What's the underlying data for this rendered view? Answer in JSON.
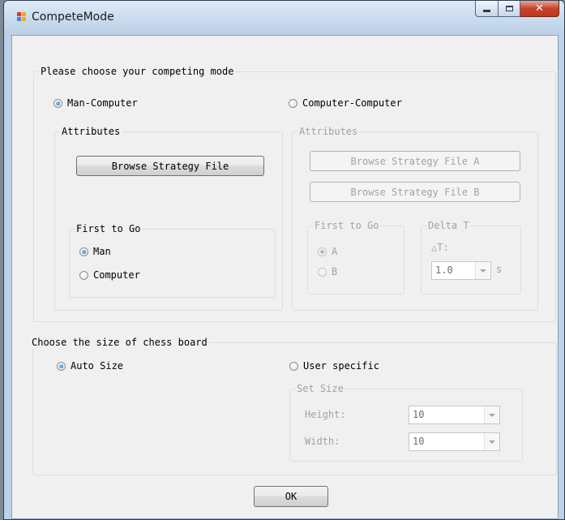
{
  "window": {
    "title": "CompeteMode"
  },
  "mode_group": {
    "legend": "Please choose your competing mode",
    "man_computer": "Man-Computer",
    "computer_computer": "Computer-Computer",
    "left_attributes": {
      "legend": "Attributes",
      "browse_button": "Browse Strategy File",
      "first_to_go": {
        "legend": "First to Go",
        "man": "Man",
        "computer": "Computer"
      }
    },
    "right_attributes": {
      "legend": "Attributes",
      "browse_a": "Browse Strategy File A",
      "browse_b": "Browse Strategy File B",
      "first_to_go": {
        "legend": "First to Go",
        "a": "A",
        "b": "B"
      },
      "delta_t": {
        "legend": "Delta T",
        "label": "△T:",
        "value": "1.0",
        "unit": "s"
      }
    }
  },
  "size_group": {
    "legend": "Choose the size of chess board",
    "auto_size": "Auto Size",
    "user_specific": "User specific",
    "set_size": {
      "legend": "Set Size",
      "height_label": "Height:",
      "height_value": "10",
      "width_label": "Width:",
      "width_value": "10"
    }
  },
  "ok_button": "OK"
}
